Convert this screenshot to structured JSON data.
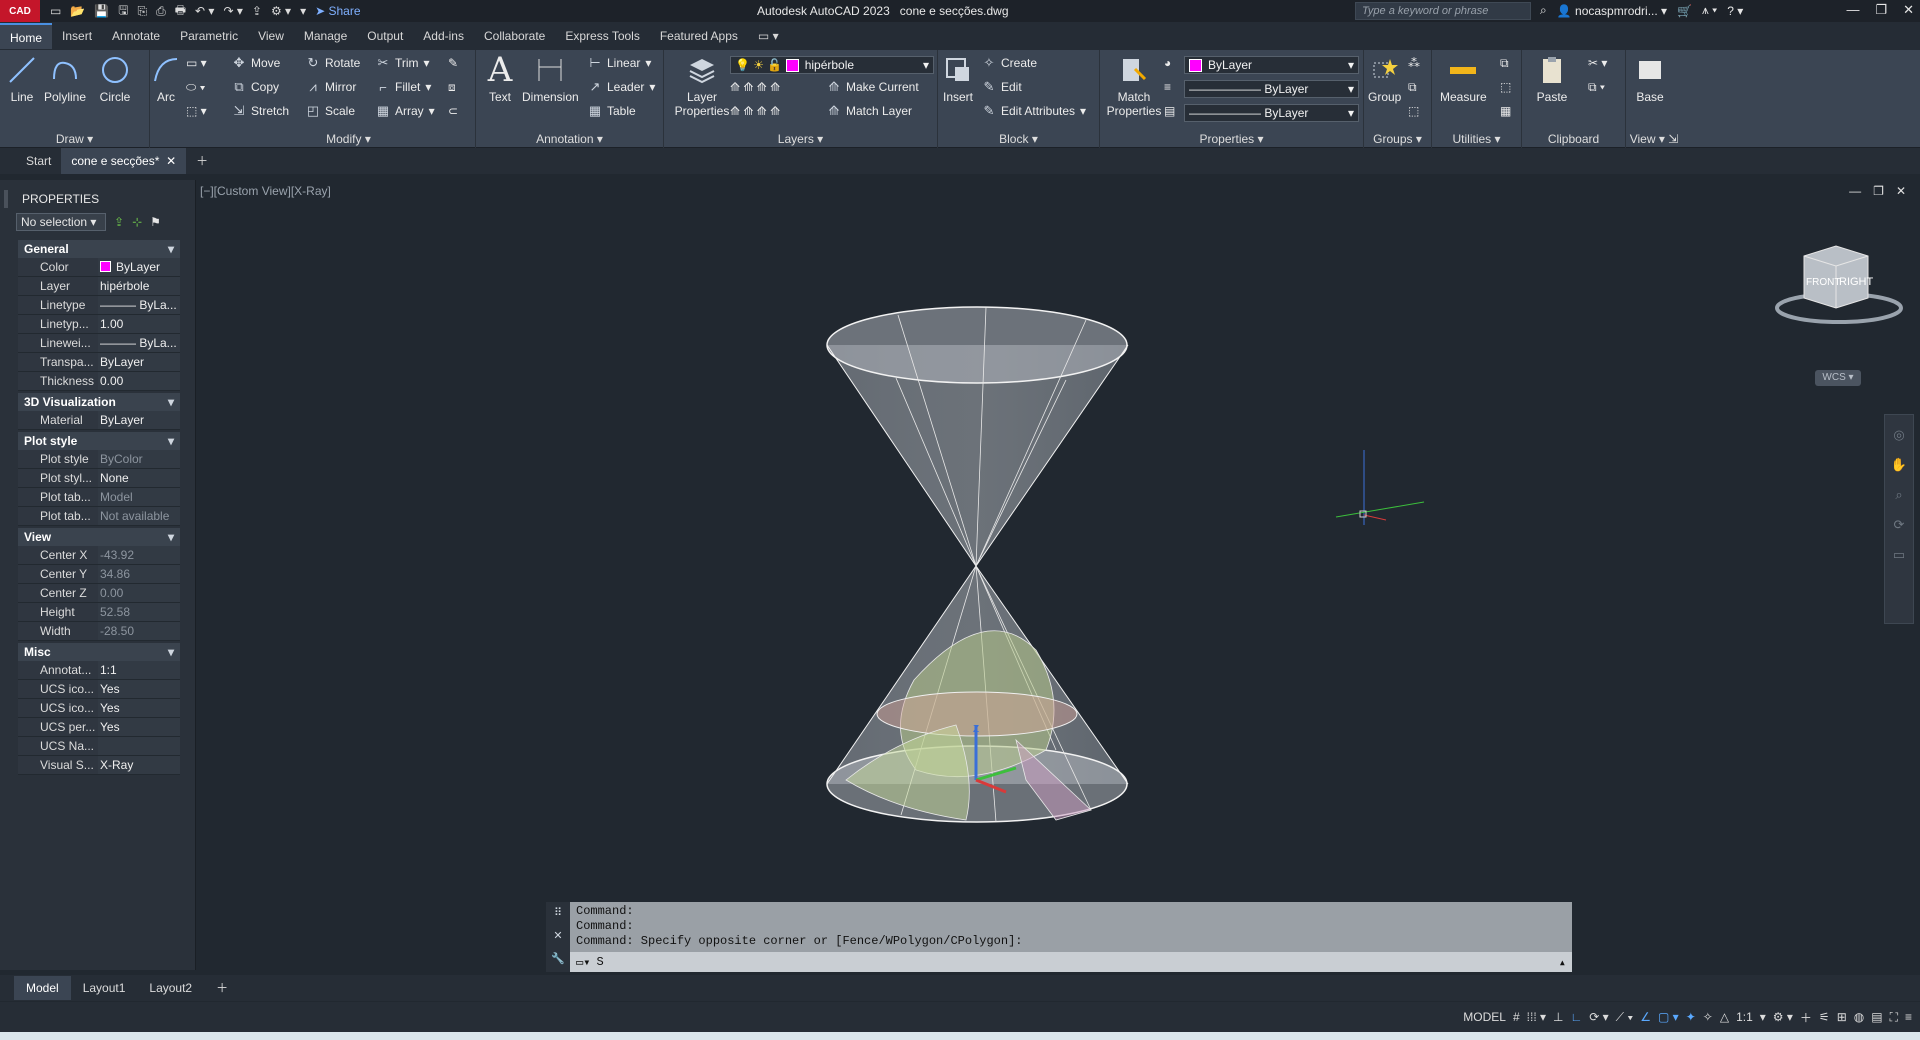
{
  "app": {
    "logo": "CAD",
    "title": "Autodesk AutoCAD 2023",
    "filename": "cone e secções.dwg",
    "search_placeholder": "Type a keyword or phrase",
    "user": "nocaspmrodri...",
    "share": "Share"
  },
  "ribbon_tabs": [
    "Home",
    "Insert",
    "Annotate",
    "Parametric",
    "View",
    "Manage",
    "Output",
    "Add-ins",
    "Collaborate",
    "Express Tools",
    "Featured Apps"
  ],
  "draw": {
    "label": "Draw",
    "line": "Line",
    "polyline": "Polyline",
    "circle": "Circle",
    "arc": "Arc"
  },
  "modify": {
    "label": "Modify",
    "move": "Move",
    "rotate": "Rotate",
    "trim": "Trim",
    "copy": "Copy",
    "mirror": "Mirror",
    "fillet": "Fillet",
    "stretch": "Stretch",
    "scale": "Scale",
    "array": "Array"
  },
  "annotation": {
    "label": "Annotation",
    "text": "Text",
    "dimension": "Dimension",
    "linear": "Linear",
    "leader": "Leader",
    "table": "Table"
  },
  "layers": {
    "label": "Layers",
    "properties": "Layer Properties",
    "current_layer": "hipérbole",
    "make_current": "Make Current",
    "match_layer": "Match Layer"
  },
  "block": {
    "label": "Block",
    "insert": "Insert",
    "create": "Create",
    "edit": "Edit",
    "edit_attributes": "Edit Attributes"
  },
  "properties_panel": {
    "label": "Properties",
    "match": "Match Properties",
    "color": "ByLayer",
    "linetype": "ByLayer",
    "lineweight": "ByLayer"
  },
  "groups": {
    "label": "Groups",
    "group": "Group"
  },
  "utilities": {
    "label": "Utilities",
    "measure": "Measure"
  },
  "clipboard": {
    "label": "Clipboard",
    "paste": "Paste"
  },
  "view_panel": {
    "label": "View",
    "base": "Base"
  },
  "file_tabs": {
    "start": "Start",
    "active": "cone e secções*"
  },
  "palette": {
    "title": "PROPERTIES",
    "selection": "No selection",
    "sections": [
      {
        "name": "General",
        "rows": [
          [
            "Color",
            "ByLayer"
          ],
          [
            "Layer",
            "hipérbole"
          ],
          [
            "Linetype",
            "——— ByLa..."
          ],
          [
            "Linetyp...",
            "1.00"
          ],
          [
            "Linewei...",
            "——— ByLa..."
          ],
          [
            "Transpa...",
            "ByLayer"
          ],
          [
            "Thickness",
            "0.00"
          ]
        ]
      },
      {
        "name": "3D Visualization",
        "rows": [
          [
            "Material",
            "ByLayer"
          ]
        ]
      },
      {
        "name": "Plot style",
        "rows": [
          [
            "Plot style",
            "ByColor"
          ],
          [
            "Plot styl...",
            "None"
          ],
          [
            "Plot tab...",
            "Model"
          ],
          [
            "Plot tab...",
            "Not available"
          ]
        ]
      },
      {
        "name": "View",
        "rows": [
          [
            "Center X",
            "-43.92"
          ],
          [
            "Center Y",
            "34.86"
          ],
          [
            "Center Z",
            "0.00"
          ],
          [
            "Height",
            "52.58"
          ],
          [
            "Width",
            "-28.50"
          ]
        ]
      },
      {
        "name": "Misc",
        "rows": [
          [
            "Annotat...",
            "1:1"
          ],
          [
            "UCS ico...",
            "Yes"
          ],
          [
            "UCS ico...",
            "Yes"
          ],
          [
            "UCS per...",
            "Yes"
          ],
          [
            "UCS Na...",
            ""
          ],
          [
            "Visual S...",
            "X-Ray"
          ]
        ]
      }
    ]
  },
  "viewport": {
    "label": "[−][Custom View][X-Ray]",
    "wcs": "WCS",
    "viewcube_front": "FRONT",
    "viewcube_right": "RIGHT"
  },
  "command": {
    "lines": [
      "Command:",
      "Command:",
      "Command: Specify opposite corner or [Fence/WPolygon/CPolygon]:"
    ],
    "input": "S"
  },
  "layouts": [
    "Model",
    "Layout1",
    "Layout2"
  ],
  "status": {
    "model": "MODEL",
    "scale": "1:1"
  },
  "colors": {
    "accent": "#4a90e2",
    "layer_color": "#ff00ff",
    "bg": "#212830",
    "ribbon": "#3b4553"
  }
}
